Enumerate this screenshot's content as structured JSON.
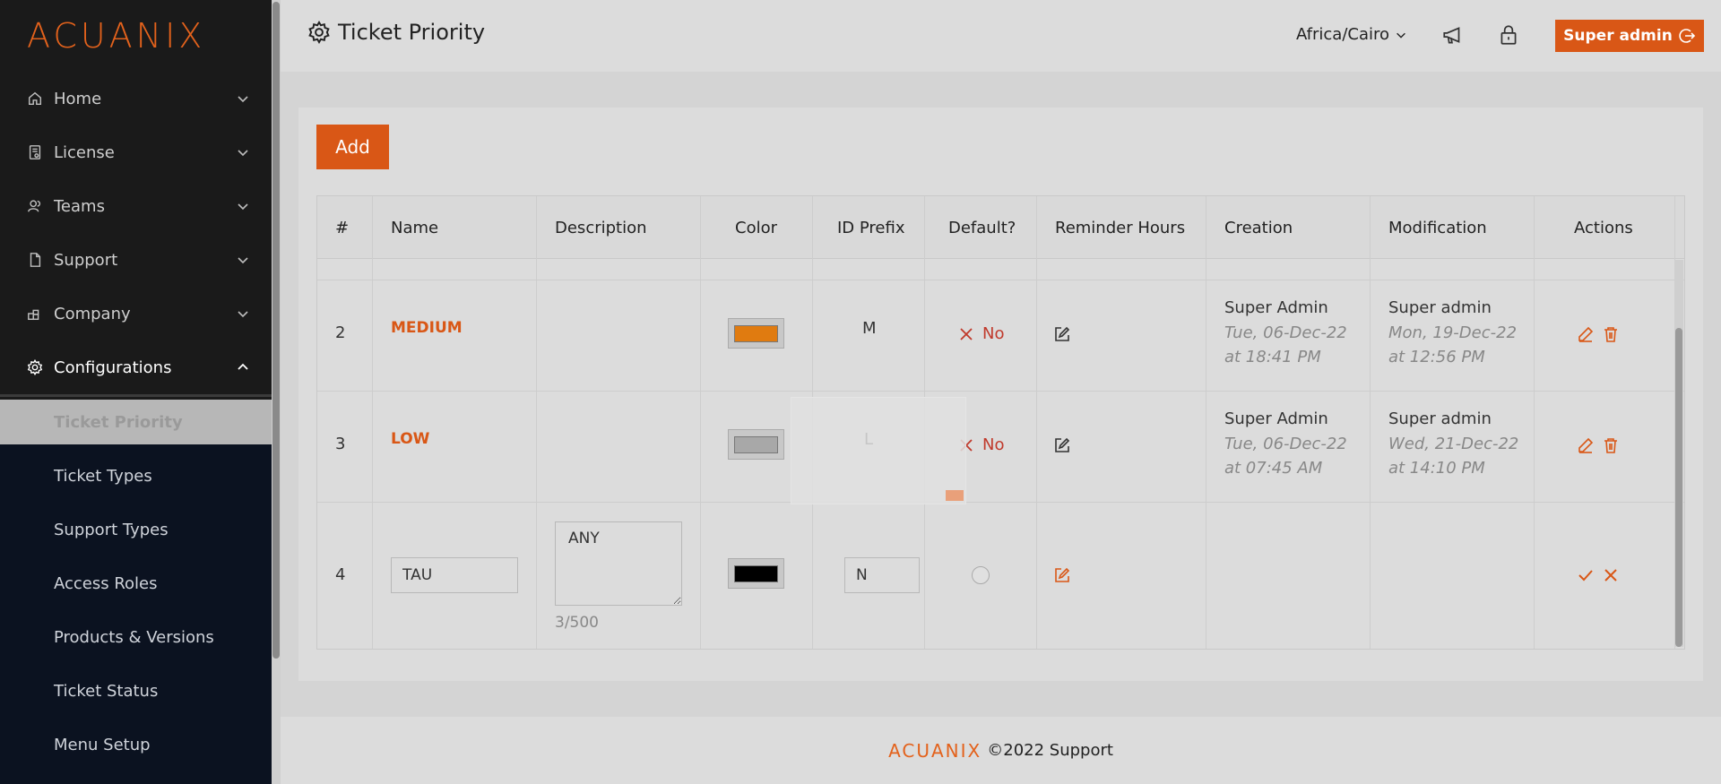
{
  "brand": {
    "logo": "ACUANIX",
    "accent": "#d95716"
  },
  "sidebar": {
    "items": [
      {
        "label": "Home",
        "icon": "home-icon"
      },
      {
        "label": "License",
        "icon": "license-icon"
      },
      {
        "label": "Teams",
        "icon": "teams-icon"
      },
      {
        "label": "Support",
        "icon": "document-icon"
      },
      {
        "label": "Company",
        "icon": "company-icon"
      },
      {
        "label": "Configurations",
        "icon": "gear-icon"
      }
    ],
    "subitems": [
      {
        "label": "Ticket Priority"
      },
      {
        "label": "Ticket Types"
      },
      {
        "label": "Support Types"
      },
      {
        "label": "Access Roles"
      },
      {
        "label": "Products & Versions"
      },
      {
        "label": "Ticket Status"
      },
      {
        "label": "Menu Setup"
      }
    ]
  },
  "header": {
    "title": "Ticket Priority",
    "timezone": "Africa/Cairo",
    "user_button": "Super admin"
  },
  "main": {
    "add_label": "Add",
    "columns": [
      "#",
      "Name",
      "Description",
      "Color",
      "ID Prefix",
      "Default?",
      "Reminder Hours",
      "Creation",
      "Modification",
      "Actions"
    ],
    "rows": [
      {
        "num": "2",
        "name": "MEDIUM",
        "color": "#e07b10",
        "prefix": "M",
        "default": "No",
        "created_by": "Super Admin",
        "created_date": "Tue, 06-Dec-22",
        "created_time": "at 18:41 PM",
        "modified_by": "Super admin",
        "modified_date": "Mon, 19-Dec-22",
        "modified_time": "at 12:56 PM"
      },
      {
        "num": "3",
        "name": "LOW",
        "color": "#a8a8a8",
        "prefix": "L",
        "default": "No",
        "created_by": "Super Admin",
        "created_date": "Tue, 06-Dec-22",
        "created_time": "at 07:45 AM",
        "modified_by": "Super admin",
        "modified_date": "Wed, 21-Dec-22",
        "modified_time": "at 14:10 PM"
      }
    ],
    "edit_row": {
      "num": "4",
      "name_value": "TAU",
      "description_value": "ANY",
      "char_count": "3/500",
      "color": "#000000",
      "prefix_value": "N"
    }
  },
  "footer": {
    "logo": "ACUANIX",
    "text": "©2022 Support"
  }
}
